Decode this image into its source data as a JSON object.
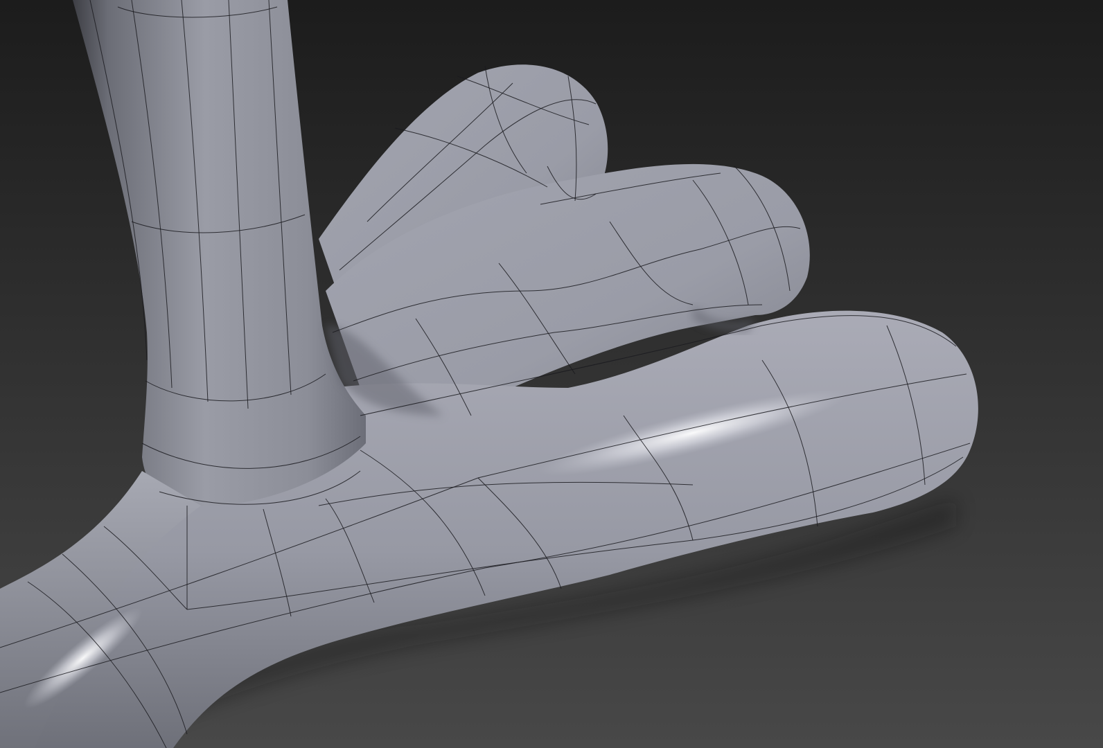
{
  "viewport": {
    "type": "3d-viewport",
    "shading": "smooth-shaded-with-wireframe-overlay",
    "subject": "subdivision-surface-mesh",
    "colors": {
      "background_top": "#1c1c1c",
      "background_bottom": "#484848",
      "surface_light": "#b2b3bd",
      "surface_mid": "#989aa5",
      "surface_dark": "#5d5f68",
      "wireframe": "#1a1a1f",
      "specular": "#ffffff"
    }
  }
}
